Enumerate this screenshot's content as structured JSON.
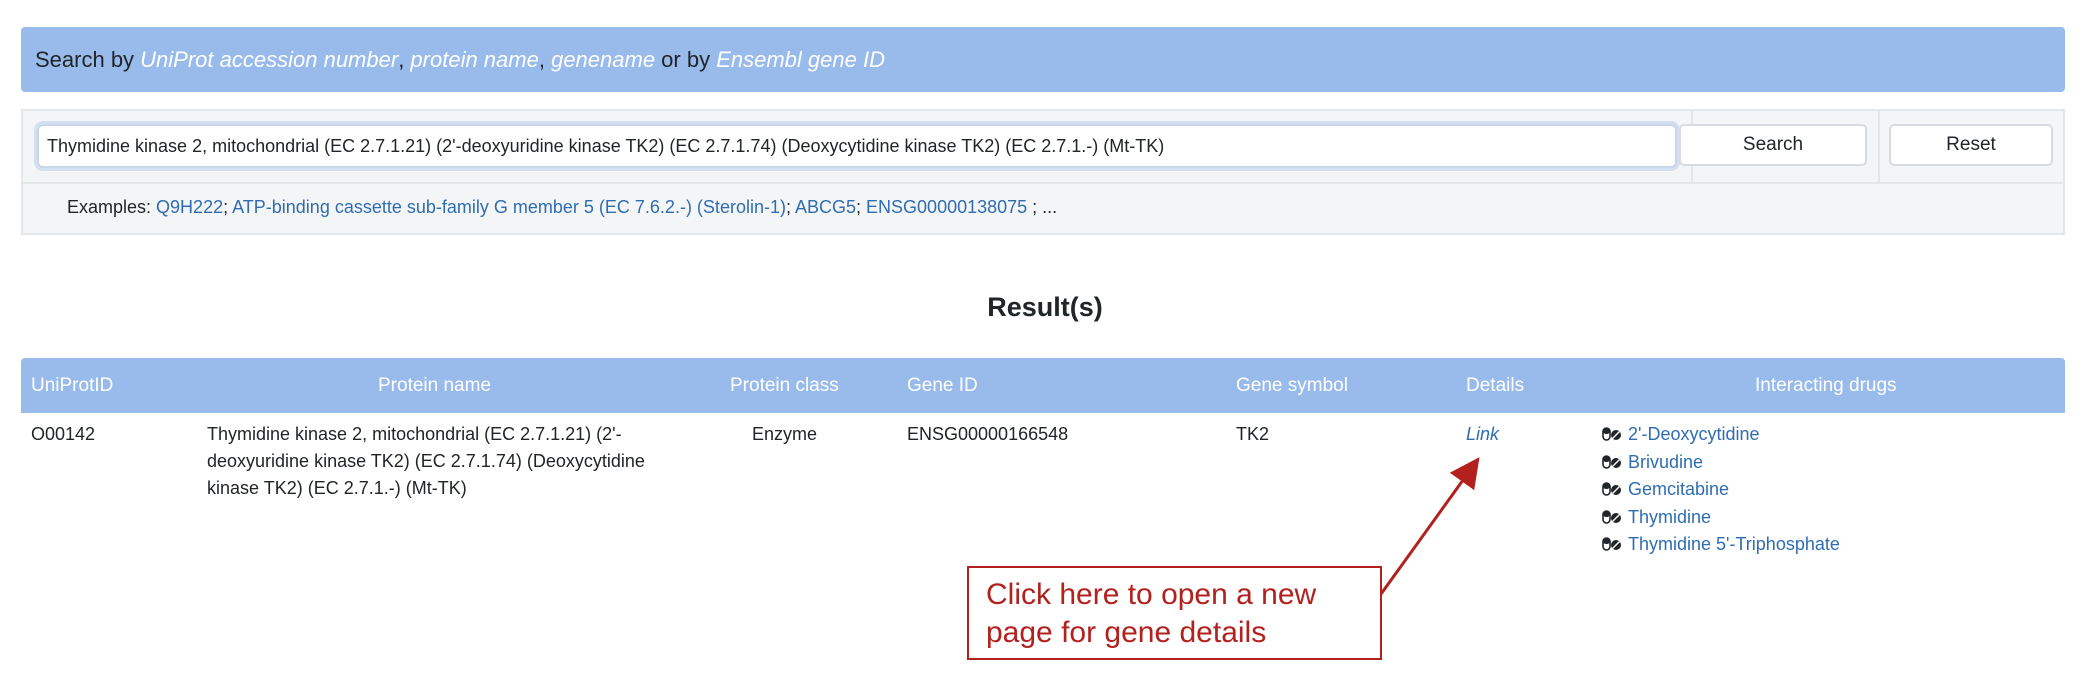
{
  "banner": {
    "prefix": "Search by ",
    "term1": "UniProt accession number",
    "sep1": ", ",
    "term2": "protein name",
    "sep2": ", ",
    "term3": "genename",
    "mid": " or by ",
    "term4": "Ensembl gene ID"
  },
  "search": {
    "value": "Thymidine kinase 2, mitochondrial (EC 2.7.1.21) (2'-deoxyuridine kinase TK2) (EC 2.7.1.74) (Deoxycytidine kinase TK2) (EC 2.7.1.-) (Mt-TK)",
    "search_label": "Search",
    "reset_label": "Reset"
  },
  "examples": {
    "label": "Examples: ",
    "items": [
      "Q9H222",
      "ATP-binding cassette sub-family G member 5 (EC 7.6.2.-) (Sterolin-1)",
      "ABCG5",
      "ENSG00000138075"
    ],
    "sep": "; ",
    "tail": " ; ..."
  },
  "results": {
    "title": "Result(s)",
    "columns": {
      "uniprot": "UniProtID",
      "protein": "Protein name",
      "class": "Protein class",
      "gene_id": "Gene ID",
      "symbol": "Gene symbol",
      "details": "Details",
      "drugs": "Interacting drugs"
    },
    "rows": [
      {
        "uniprot": "O00142",
        "protein": "Thymidine kinase 2, mitochondrial (EC 2.7.1.21) (2'-deoxyuridine kinase TK2) (EC 2.7.1.74) (Deoxycytidine kinase TK2) (EC 2.7.1.-) (Mt-TK)",
        "class": "Enzyme",
        "gene_id": "ENSG00000166548",
        "symbol": "TK2",
        "details": "Link",
        "drugs": [
          "2'-Deoxycytidine",
          "Brivudine",
          "Gemcitabine",
          "Thymidine",
          "Thymidine 5'-Triphosphate"
        ]
      }
    ]
  },
  "callout": {
    "text": "Click here to open a new page for gene details",
    "color": "#b3211e"
  },
  "colors": {
    "accent": "#98bbeb",
    "link": "#2f6db2"
  }
}
